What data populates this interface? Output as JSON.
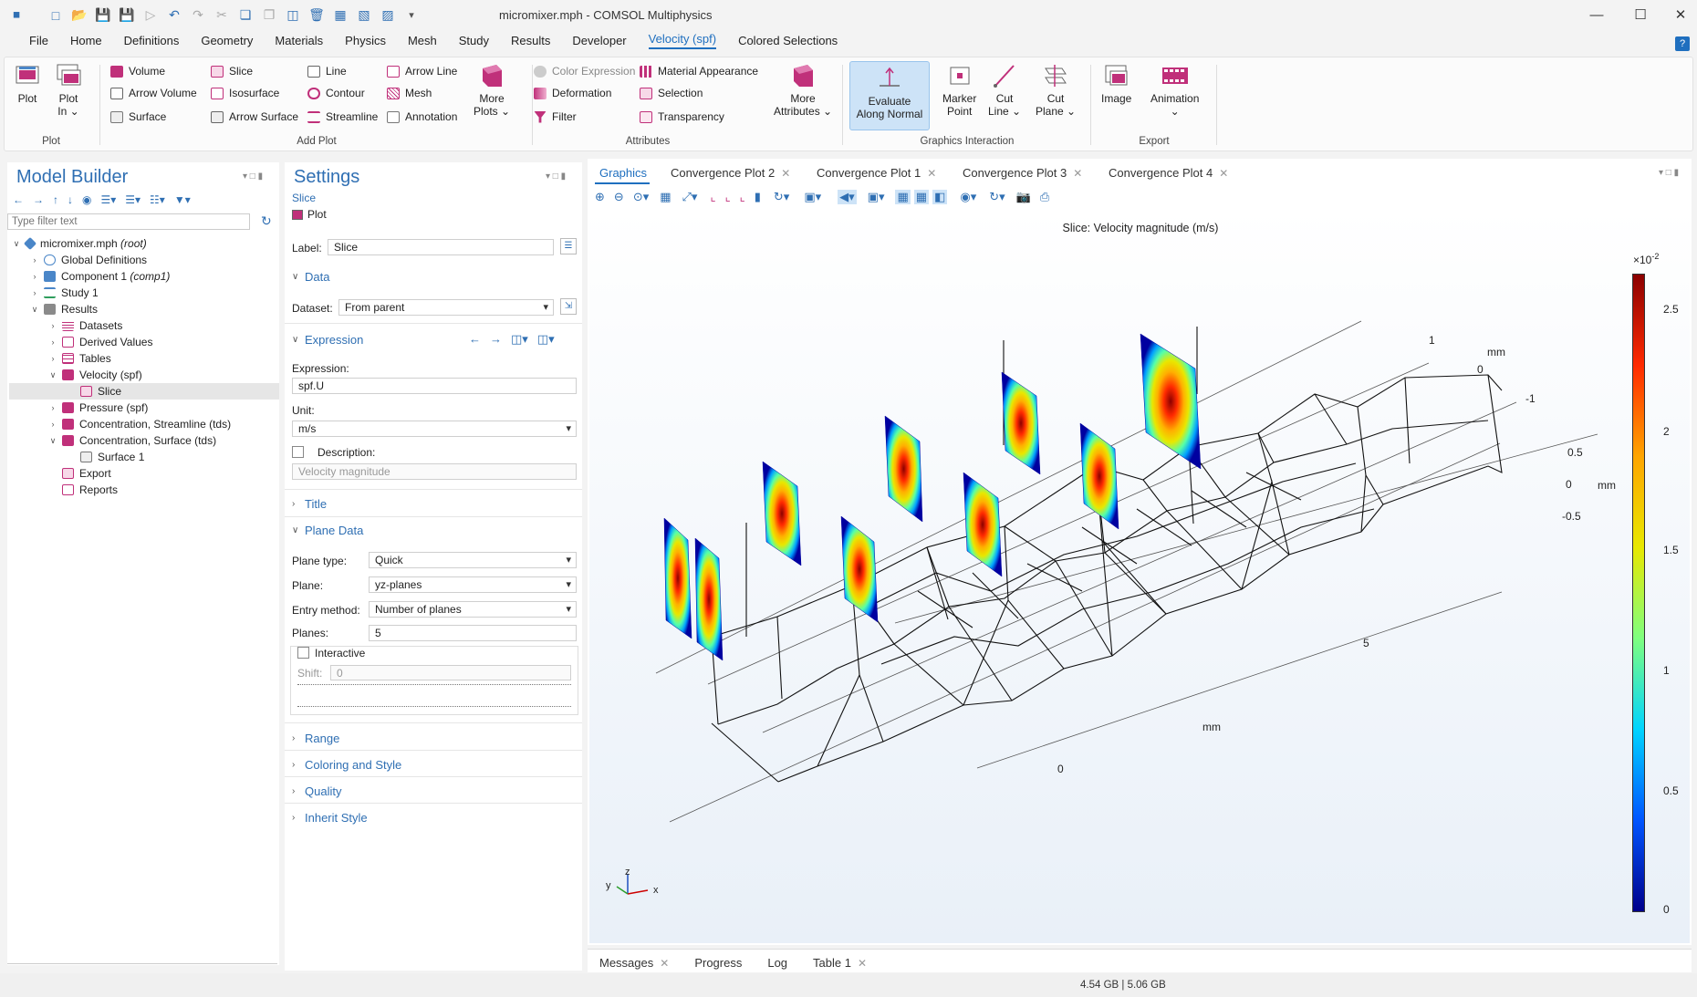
{
  "window": {
    "title": "micromixer.mph - COMSOL Multiphysics"
  },
  "menu": [
    "File",
    "Home",
    "Definitions",
    "Geometry",
    "Materials",
    "Physics",
    "Mesh",
    "Study",
    "Results",
    "Developer",
    "Velocity (spf)",
    "Colored Selections"
  ],
  "ribbon": {
    "plot_group": {
      "label": "Plot",
      "plot": "Plot",
      "plot_in_1": "Plot",
      "plot_in_2": "In ⌄"
    },
    "add_plot": {
      "label": "Add Plot",
      "volume": "Volume",
      "arrow_volume": "Arrow Volume",
      "surface": "Surface",
      "slice": "Slice",
      "isosurface": "Isosurface",
      "arrow_surface": "Arrow Surface",
      "line": "Line",
      "contour": "Contour",
      "streamline": "Streamline",
      "arrow_line": "Arrow Line",
      "mesh": "Mesh",
      "annotation": "Annotation",
      "more_plots_1": "More",
      "more_plots_2": "Plots ⌄"
    },
    "attributes": {
      "label": "Attributes",
      "color_expression": "Color Expression",
      "deformation": "Deformation",
      "filter": "Filter",
      "material_appearance": "Material Appearance",
      "selection": "Selection",
      "transparency": "Transparency",
      "more_1": "More",
      "more_2": "Attributes ⌄"
    },
    "graphics_interaction": {
      "label": "Graphics Interaction",
      "evaluate_1": "Evaluate",
      "evaluate_2": "Along Normal",
      "marker_1": "Marker",
      "marker_2": "Point",
      "cutline_1": "Cut",
      "cutline_2": "Line ⌄",
      "cutplane_1": "Cut",
      "cutplane_2": "Plane ⌄"
    },
    "export": {
      "label": "Export",
      "image": "Image",
      "animation_1": "Animation",
      "animation_2": "⌄"
    }
  },
  "model_builder": {
    "title": "Model Builder",
    "filter_placeholder": "Type filter text",
    "tree": [
      {
        "label": "micromixer.mph",
        "suffix": "(root)"
      },
      {
        "label": "Global Definitions"
      },
      {
        "label": "Component 1",
        "suffix": "(comp1)"
      },
      {
        "label": "Study 1"
      },
      {
        "label": "Results"
      },
      {
        "label": "Datasets"
      },
      {
        "label": "Derived Values"
      },
      {
        "label": "Tables"
      },
      {
        "label": "Velocity (spf)"
      },
      {
        "label": "Slice"
      },
      {
        "label": "Pressure (spf)"
      },
      {
        "label": "Concentration, Streamline (tds)"
      },
      {
        "label": "Concentration, Surface (tds)"
      },
      {
        "label": "Surface 1"
      },
      {
        "label": "Export"
      },
      {
        "label": "Reports"
      }
    ]
  },
  "settings": {
    "title": "Settings",
    "subtitle": "Slice",
    "plot_btn": "Plot",
    "label_caption": "Label:",
    "label_value": "Slice",
    "data_section": "Data",
    "dataset_caption": "Dataset:",
    "dataset_value": "From parent",
    "expression_section": "Expression",
    "expression_caption": "Expression:",
    "expression_value": "spf.U",
    "unit_caption": "Unit:",
    "unit_value": "m/s",
    "description_caption": "Description:",
    "description_value": "Velocity magnitude",
    "title_section": "Title",
    "plane_data_section": "Plane Data",
    "plane_type_caption": "Plane type:",
    "plane_type_value": "Quick",
    "plane_caption": "Plane:",
    "plane_value": "yz-planes",
    "entry_method_caption": "Entry method:",
    "entry_method_value": "Number of planes",
    "planes_caption": "Planes:",
    "planes_value": "5",
    "interactive_caption": "Interactive",
    "shift_caption": "Shift:",
    "shift_value": "0",
    "range_section": "Range",
    "coloring_section": "Coloring and Style",
    "quality_section": "Quality",
    "inherit_section": "Inherit Style"
  },
  "graphics": {
    "tabs": [
      "Graphics",
      "Convergence Plot 2",
      "Convergence Plot 1",
      "Convergence Plot 3",
      "Convergence Plot 4"
    ],
    "plot_title": "Slice: Velocity magnitude (m/s)",
    "colorbar": {
      "exponent": "×10",
      "exponent_power": "-2",
      "ticks": [
        "2.5",
        "2",
        "1.5",
        "1",
        "0.5",
        "0"
      ],
      "colors": [
        "#8b0000",
        "#ff2a00",
        "#ffa500",
        "#e8e800",
        "#7fff7f",
        "#00d4ff",
        "#0055ff",
        "#00008b"
      ]
    },
    "axis_labels": {
      "z_top": "1",
      "z_mm": "mm",
      "z_mid": "0",
      "z_low": "-1",
      "y_a": "0.5",
      "y_b": "0",
      "y_c": "-0.5",
      "y_mm": "mm",
      "x_5": "5",
      "x_mm": "mm",
      "x_0": "0"
    },
    "triad": {
      "z": "z",
      "y": "y",
      "x": "x"
    }
  },
  "bottom_tabs": [
    "Messages",
    "Progress",
    "Log",
    "Table 1"
  ],
  "status": {
    "memory": "4.54 GB | 5.06 GB"
  }
}
